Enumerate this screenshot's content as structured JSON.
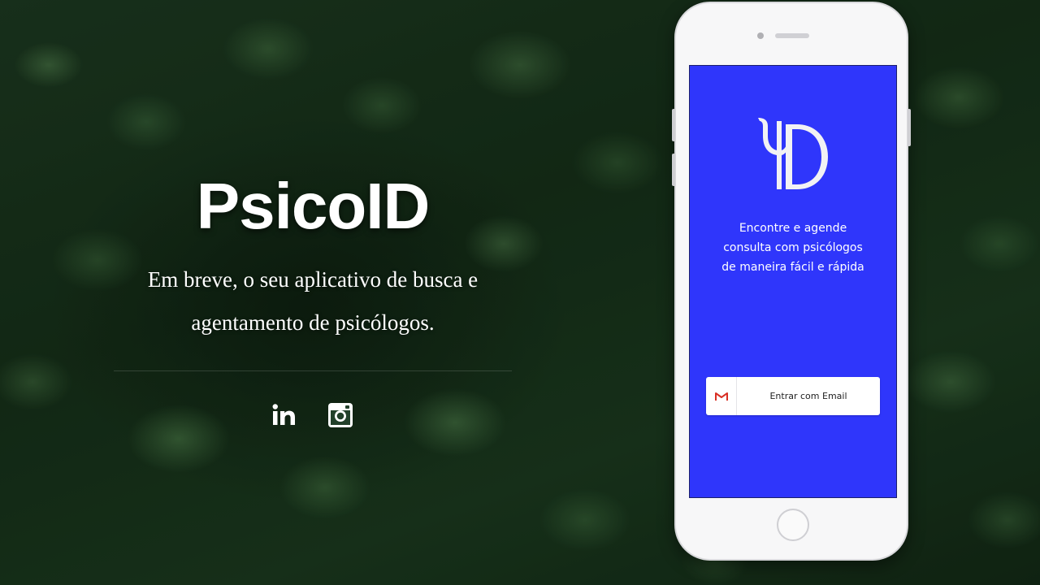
{
  "hero": {
    "title": "PsicoID",
    "subtitle_line1": "Em breve, o seu aplicativo de busca e",
    "subtitle_line2": "agentamento de psicólogos."
  },
  "social": [
    {
      "name": "LinkedIn",
      "icon": "linkedin-icon",
      "label": "in"
    },
    {
      "name": "Instagram",
      "icon": "instagram-icon"
    }
  ],
  "phone": {
    "screen_color": "#2f36fb",
    "logo_icon": "psi-d-logo",
    "tagline_line1": "Encontre e agende",
    "tagline_line2": "consulta com psicólogos",
    "tagline_line3": "de maneira fácil e rápida",
    "email_button": {
      "icon": "gmail-icon",
      "label": "Entrar com Email"
    }
  },
  "colors": {
    "accent_blue": "#2f36fb",
    "gmail_red": "#d93025",
    "text_white": "#ffffff"
  }
}
